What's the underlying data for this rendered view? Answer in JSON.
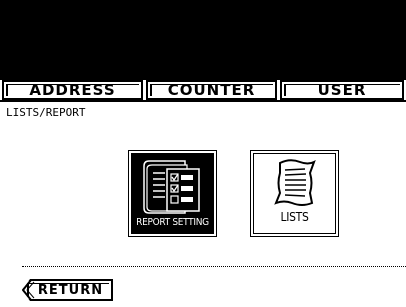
{
  "tabs": [
    {
      "label": "ADDRESS"
    },
    {
      "label": "COUNTER"
    },
    {
      "label": "USER"
    }
  ],
  "breadcrumb": "LISTS/REPORT",
  "buttons": {
    "report_setting": "REPORT SETTING",
    "lists": "LISTS",
    "return": "RETURN"
  },
  "colors": {
    "background": "#ffffff",
    "header": "#000000",
    "ink": "#000000"
  },
  "icons": {
    "report_setting": "report-checklist-icon",
    "lists": "scroll-list-icon",
    "return": "back-arrow-tab"
  }
}
